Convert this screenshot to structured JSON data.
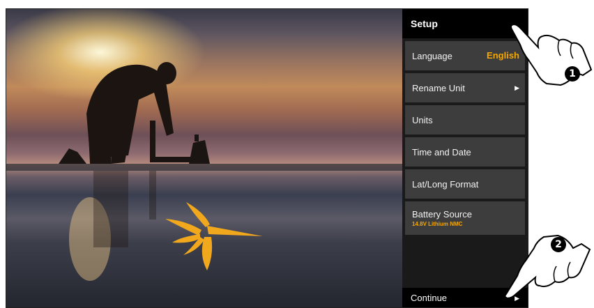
{
  "panel": {
    "title": "Setup",
    "items": [
      {
        "label": "Language",
        "value": "English"
      },
      {
        "label": "Rename Unit",
        "arrow": "▶"
      },
      {
        "label": "Units"
      },
      {
        "label": "Time and Date"
      },
      {
        "label": "Lat/Long Format"
      },
      {
        "label": "Battery Source",
        "sub": "14.8V Lithium NMC"
      }
    ],
    "continue": {
      "label": "Continue",
      "arrow": "▶"
    }
  },
  "callouts": {
    "first": "1",
    "second": "2"
  },
  "colors": {
    "accent": "#f7a800",
    "panel_bg": "#1a1a1a",
    "item_bg": "#3d3d3d"
  },
  "icons": {
    "logo": "hummingbird-logo",
    "pointer": "hand-pointer-icon"
  }
}
